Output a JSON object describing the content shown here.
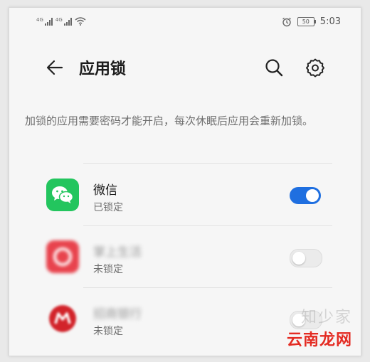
{
  "status_bar": {
    "signal1_tag": "4G",
    "signal2_tag": "4G",
    "battery": "50",
    "time": "5:03"
  },
  "header": {
    "title": "应用锁"
  },
  "description": "加锁的应用需要密码才能开启，每次休眠后应用会重新加锁。",
  "apps": [
    {
      "name": "微信",
      "status": "已锁定",
      "locked": true,
      "icon": "wechat-icon",
      "color": "#1db954"
    },
    {
      "name": "掌上生活",
      "status": "未锁定",
      "locked": false,
      "icon": "app-icon-blurred",
      "color": "#e0404a"
    },
    {
      "name": "招商银行",
      "status": "未锁定",
      "locked": false,
      "icon": "cmb-icon",
      "color": "#d2232a"
    }
  ],
  "watermark": {
    "line1": "知少家",
    "line2": "云南龙网"
  },
  "colors": {
    "accent": "#1f6fe0",
    "background": "#f6f6f6"
  }
}
